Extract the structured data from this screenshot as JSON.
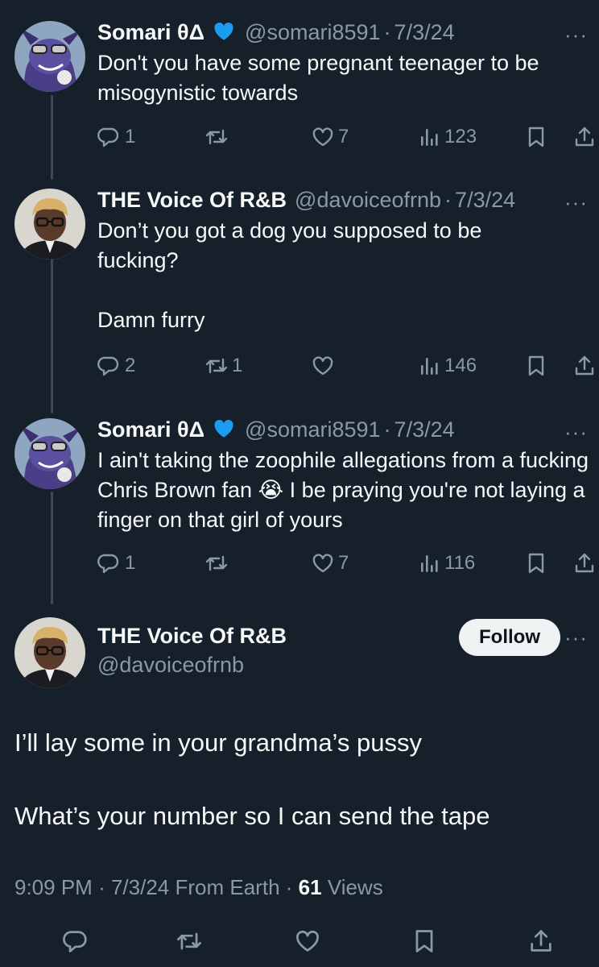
{
  "tweets": [
    {
      "name": "Somari θΔ",
      "handle": "@somari8591",
      "sep": "·",
      "date": "7/3/24",
      "lines": [
        "Don't you have some pregnant teenager to be misogynistic towards"
      ],
      "replies": "1",
      "retweets": "",
      "likes": "7",
      "views": "123",
      "verified": true
    },
    {
      "name": "THE Voice Of R&B",
      "handle": "@davoiceofrnb",
      "sep": "·",
      "date": "7/3/24",
      "lines": [
        "Don’t you got a dog you supposed to be fucking?",
        "Damn furry"
      ],
      "replies": "2",
      "retweets": "1",
      "likes": "",
      "views": "146",
      "verified": false
    },
    {
      "name": "Somari θΔ",
      "handle": "@somari8591",
      "sep": "·",
      "date": "7/3/24",
      "text_a": "I ain't taking the zoophile allegations from a fucking Chris Brown fan",
      "emoji": "😭",
      "text_b": "I be praying you're not laying a finger on that girl of yours",
      "replies": "1",
      "retweets": "",
      "likes": "7",
      "views": "116",
      "verified": true
    }
  ],
  "main_tweet": {
    "name": "THE Voice Of R&B",
    "handle": "@davoiceofrnb",
    "follow_label": "Follow",
    "line1": "I’ll lay some in your grandma’s pussy",
    "line2": "What’s your number so I can send the tape",
    "time": "9:09 PM",
    "sep1": "·",
    "date": "7/3/24",
    "source": "From Earth",
    "sep2": "·",
    "views_count": "61",
    "views_label": "Views"
  },
  "more_glyph": "···",
  "icons": [
    "reply-icon",
    "retweet-icon",
    "like-icon",
    "views-icon",
    "bookmark-icon",
    "share-icon",
    "verified-heart-icon",
    "more-icon"
  ],
  "colors": {
    "background": "#15202b",
    "text": "#f7f9f9",
    "muted": "#8b98a5",
    "verified_heart": "#1d9bf0",
    "thread_line": "#3d4a56",
    "follow_bg": "#eff3f4"
  }
}
